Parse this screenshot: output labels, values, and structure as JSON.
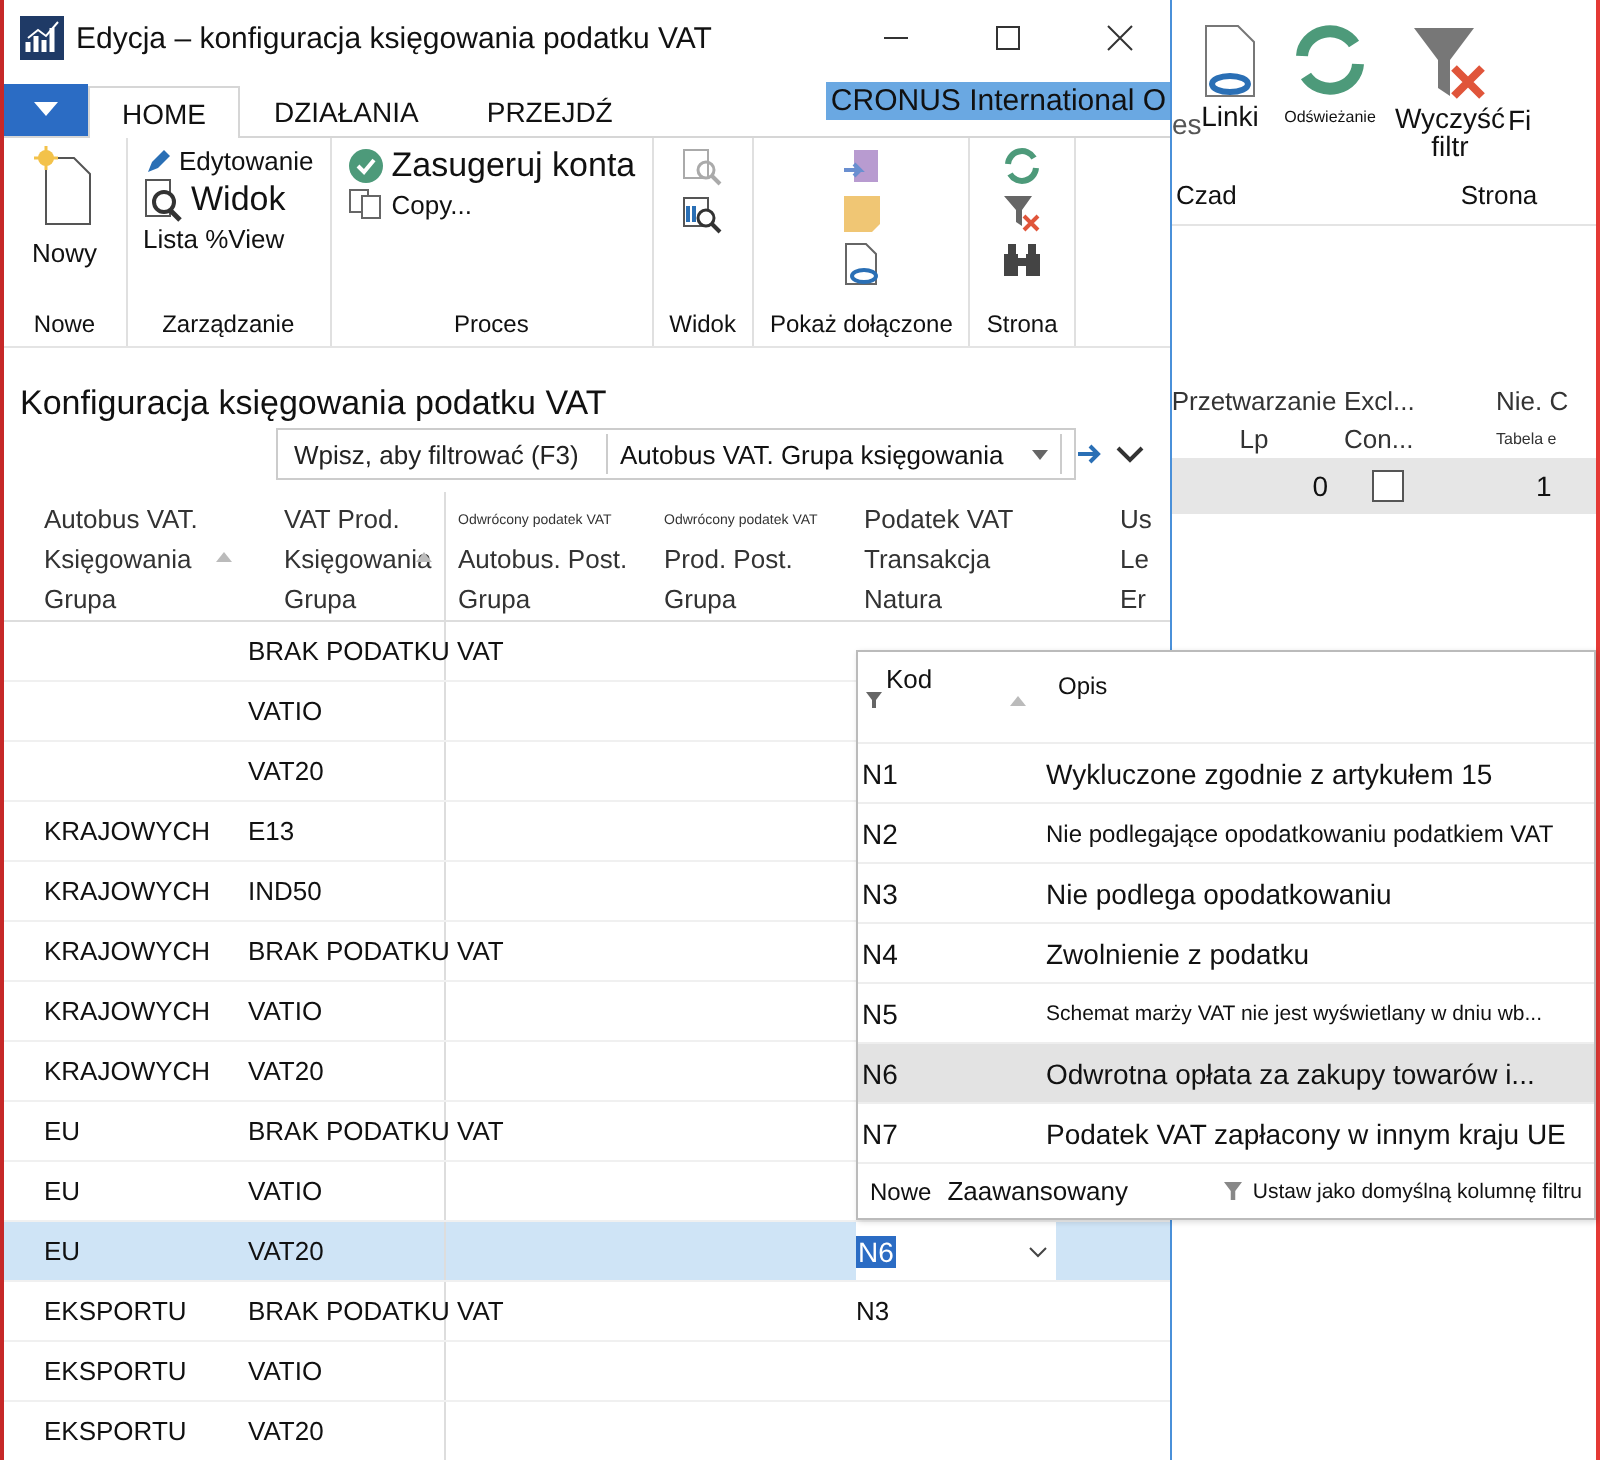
{
  "back_window": {
    "ribbon": {
      "item_1_label": "es",
      "links": "Linki",
      "refresh": "Odświeżanie",
      "clear_filter": [
        "Wyczyść",
        "filtr"
      ],
      "item_4_label": "Fi",
      "groups": [
        "Czad",
        "Strona"
      ]
    },
    "columns": [
      {
        "lines": [
          "Przetwarzanie",
          "Lp"
        ]
      },
      {
        "lines": [
          "Excl...",
          "Con..."
        ]
      },
      {
        "lines": [
          "Nie. C"
        ],
        "note": "Tabela e"
      }
    ],
    "row": {
      "number": "0",
      "checked": false,
      "column_3": "1"
    }
  },
  "window": {
    "title": "Edycja – konfiguracja księgowania podatku VAT"
  },
  "tabs": [
    {
      "label": "HOME",
      "selected": true
    },
    {
      "label": "DZIAŁANIA",
      "selected": false
    },
    {
      "label": "PRZEJDŹ",
      "selected": false
    }
  ],
  "company": "CRONUS International O",
  "ribbon": {
    "groups": [
      {
        "label": "Nowe",
        "items": [
          {
            "kind": "big",
            "label": "Nowy"
          }
        ]
      },
      {
        "label": "Zarządzanie",
        "items": [
          {
            "kind": "small",
            "label": "Edytowanie"
          },
          {
            "kind": "large",
            "label": "Widok"
          },
          {
            "kind": "small",
            "label": "Lista %View"
          }
        ]
      },
      {
        "label": "Proces",
        "items": [
          {
            "kind": "large",
            "label": "Zasugeruj konta"
          },
          {
            "kind": "small",
            "label": "Copy..."
          }
        ]
      },
      {
        "label": "Widok",
        "items": [
          {
            "kind": "icon"
          },
          {
            "kind": "icon"
          }
        ]
      },
      {
        "label": "Pokaż dołączone",
        "items": [
          {
            "kind": "icon"
          },
          {
            "kind": "icon"
          },
          {
            "kind": "icon"
          }
        ]
      },
      {
        "label": "Strona",
        "items": [
          {
            "kind": "icon"
          },
          {
            "kind": "icon"
          },
          {
            "kind": "icon"
          }
        ]
      }
    ]
  },
  "page_title": "Konfiguracja księgowania podatku VAT",
  "filter": {
    "placeholder": "Wpisz, aby filtrować (F3)",
    "field": "Autobus VAT. Grupa księgowania"
  },
  "table": {
    "columns": [
      {
        "lines": [
          "Autobus VAT.",
          "Księgowania",
          "Grupa"
        ],
        "sorted": true
      },
      {
        "lines": [
          "VAT Prod.",
          "Księgowania",
          "Grupa"
        ],
        "sorted": true
      },
      {
        "note": "Odwrócony podatek VAT",
        "lines": [
          "Autobus. Post.",
          "Grupa"
        ],
        "sorted": false
      },
      {
        "note": "Odwrócony podatek VAT",
        "lines": [
          "Prod. Post.",
          "Grupa"
        ],
        "sorted": false
      },
      {
        "lines": [
          "Podatek VAT",
          "Transakcja",
          "Natura"
        ],
        "sorted": false
      },
      {
        "lines": [
          "Us",
          "Le",
          "Er"
        ],
        "sorted": false
      }
    ],
    "rows": [
      {
        "bus": "",
        "prod": "BRAK PODATKU VAT",
        "selected": false
      },
      {
        "bus": "",
        "prod": "VATIO",
        "selected": false
      },
      {
        "bus": "",
        "prod": "VAT20",
        "selected": false
      },
      {
        "bus": "KRAJOWYCH",
        "prod": "E13",
        "selected": false
      },
      {
        "bus": "KRAJOWYCH",
        "prod": "IND50",
        "selected": false
      },
      {
        "bus": "KRAJOWYCH",
        "prod": "BRAK PODATKU VAT",
        "selected": false
      },
      {
        "bus": "KRAJOWYCH",
        "prod": "VATIO",
        "selected": false
      },
      {
        "bus": "KRAJOWYCH",
        "prod": "VAT20",
        "selected": false
      },
      {
        "bus": "EU",
        "prod": "BRAK PODATKU VAT",
        "selected": false
      },
      {
        "bus": "EU",
        "prod": "VATIO",
        "selected": false
      },
      {
        "bus": "EU",
        "prod": "VAT20",
        "nature": "N6",
        "selected": true
      },
      {
        "bus": "EKSPORTU",
        "prod": "BRAK PODATKU VAT",
        "nature": "N3",
        "selected": false
      },
      {
        "bus": "EKSPORTU",
        "prod": "VATIO",
        "selected": false
      },
      {
        "bus": "EKSPORTU",
        "prod": "VAT20",
        "selected": false
      }
    ]
  },
  "lookup": {
    "columns": [
      "Kod",
      "Opis"
    ],
    "items": [
      {
        "code": "N1",
        "text": "Wykluczone zgodnie z artykułem 15",
        "selected": false
      },
      {
        "code": "N2",
        "text": "Nie podlegające opodatkowaniu podatkiem VAT",
        "selected": false
      },
      {
        "code": "N3",
        "text": "Nie podlega opodatkowaniu",
        "selected": false
      },
      {
        "code": "N4",
        "text": "Zwolnienie z podatku",
        "selected": false
      },
      {
        "code": "N5",
        "text": "Schemat marży VAT nie jest wyświetlany w dniu wb...",
        "selected": false
      },
      {
        "code": "N6",
        "text": "Odwrotna opłata za zakupy towarów i...",
        "selected": true
      },
      {
        "code": "N7",
        "text": "Podatek VAT zapłacony w innym kraju UE",
        "selected": false
      }
    ],
    "footer": {
      "new": "Nowe",
      "advanced": "Zaawansowany",
      "default_filter": "Ustaw jako domyślną kolumnę filtru"
    }
  }
}
